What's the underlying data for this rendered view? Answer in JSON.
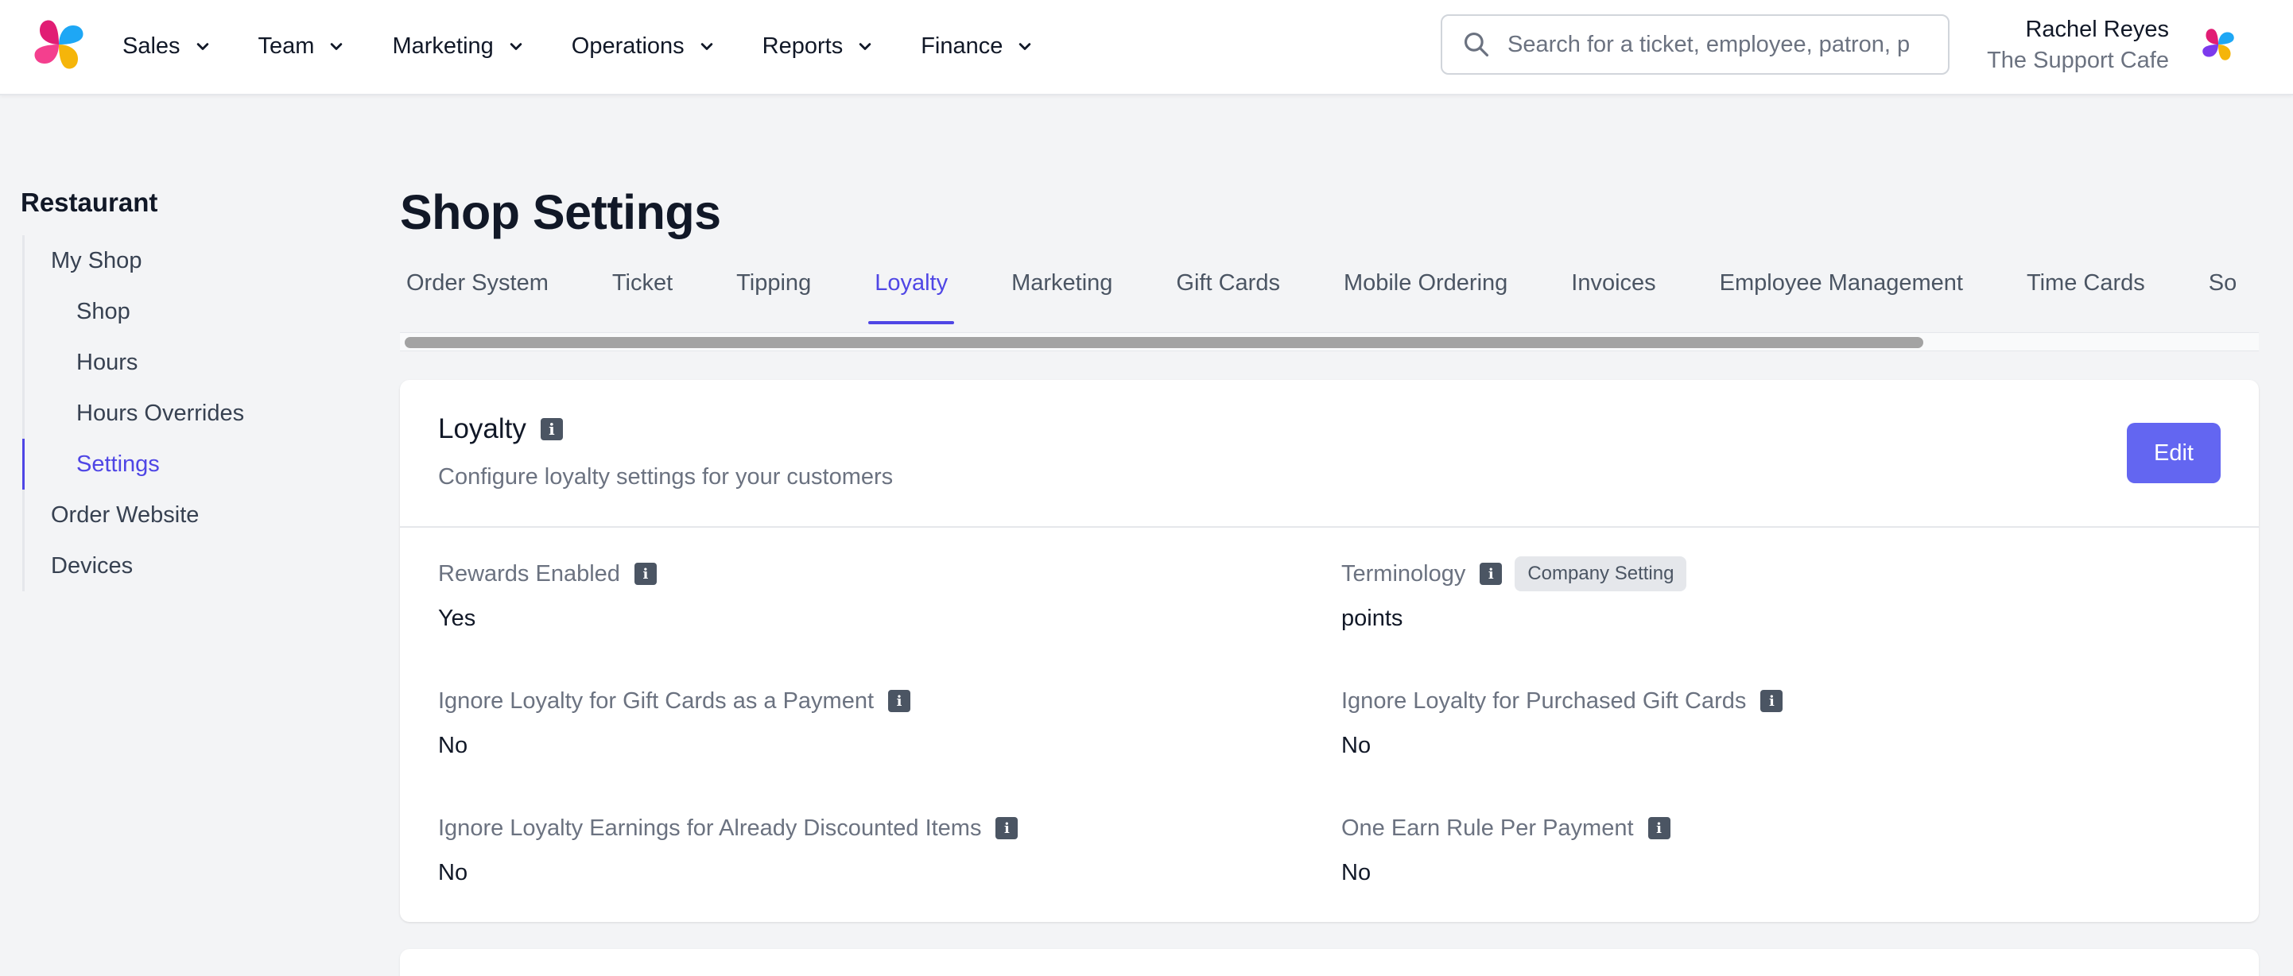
{
  "nav": {
    "items": [
      {
        "label": "Sales"
      },
      {
        "label": "Team"
      },
      {
        "label": "Marketing"
      },
      {
        "label": "Operations"
      },
      {
        "label": "Reports"
      },
      {
        "label": "Finance"
      }
    ]
  },
  "search": {
    "placeholder": "Search for a ticket, employee, patron, p"
  },
  "user": {
    "name": "Rachel Reyes",
    "org": "The Support Cafe"
  },
  "sidebar": {
    "title": "Restaurant",
    "items": [
      {
        "label": "My Shop"
      },
      {
        "label": "Shop"
      },
      {
        "label": "Hours"
      },
      {
        "label": "Hours Overrides"
      },
      {
        "label": "Settings"
      },
      {
        "label": "Order Website"
      },
      {
        "label": "Devices"
      }
    ]
  },
  "page": {
    "title": "Shop Settings"
  },
  "tabs": [
    {
      "label": "Order System"
    },
    {
      "label": "Ticket"
    },
    {
      "label": "Tipping"
    },
    {
      "label": "Loyalty"
    },
    {
      "label": "Marketing"
    },
    {
      "label": "Gift Cards"
    },
    {
      "label": "Mobile Ordering"
    },
    {
      "label": "Invoices"
    },
    {
      "label": "Employee Management"
    },
    {
      "label": "Time Cards"
    },
    {
      "label": "So"
    }
  ],
  "card": {
    "title": "Loyalty",
    "subtitle": "Configure loyalty settings for your customers",
    "edit_label": "Edit",
    "fields": [
      {
        "label": "Rewards Enabled",
        "value": "Yes"
      },
      {
        "label": "Terminology",
        "badge": "Company Setting",
        "value": "points"
      },
      {
        "label": "Ignore Loyalty for Gift Cards as a Payment",
        "value": "No"
      },
      {
        "label": "Ignore Loyalty for Purchased Gift Cards",
        "value": "No"
      },
      {
        "label": "Ignore Loyalty Earnings for Already Discounted Items",
        "value": "No"
      },
      {
        "label": "One Earn Rule Per Payment",
        "value": "No"
      }
    ]
  },
  "colors": {
    "accent": "#4f46e5",
    "button": "#6366f1",
    "logo": [
      "#e11d74",
      "#1ea7f5",
      "#f5b50a",
      "#7c3aed"
    ]
  },
  "icons": {
    "logo": "pinwheel-logo",
    "search": "search-icon",
    "chevron": "chevron-down-icon",
    "info": "info-icon"
  }
}
